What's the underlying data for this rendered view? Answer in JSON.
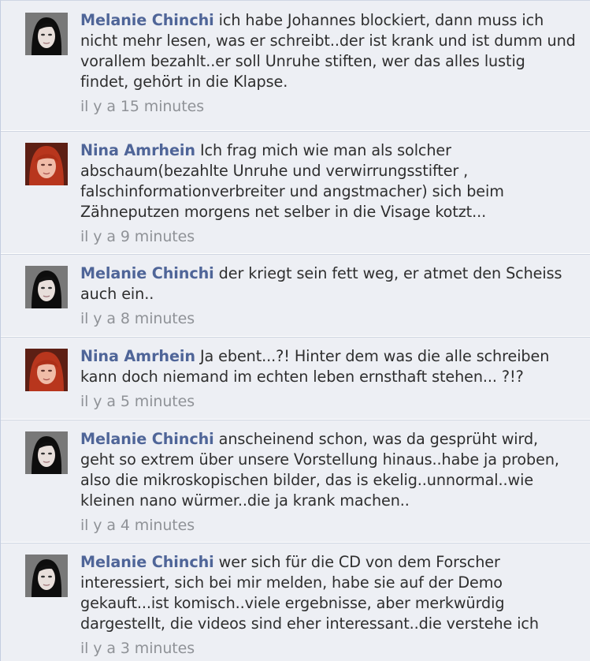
{
  "comments": [
    {
      "author": "Melanie Chinchi",
      "avatar": "melanie-avatar",
      "text": "ich habe Johannes blockiert, dann muss ich nicht mehr lesen, was er schreibt..der ist krank und ist dumm und vorallem bezahlt..er soll Unruhe stiften, wer das alles lustig findet, gehört in die Klapse.",
      "time": "il y a 15 minutes"
    },
    {
      "author": "Nina Amrhein",
      "avatar": "nina-avatar",
      "text": "Ich frag mich wie man als solcher abschaum(bezahlte Unruhe und verwirrungsstifter , falschinformationverbreiter und angstmacher) sich beim Zähneputzen morgens net selber in die Visage kotzt...",
      "time": "il y a 9 minutes"
    },
    {
      "author": "Melanie Chinchi",
      "avatar": "melanie-avatar",
      "text": "der kriegt sein fett weg, er atmet den Scheiss auch ein..",
      "time": "il y a 8 minutes"
    },
    {
      "author": "Nina Amrhein",
      "avatar": "nina-avatar",
      "text": "Ja ebent...?! Hinter dem was die alle schreiben kann doch niemand im echten leben ernsthaft stehen... ?!?",
      "time": "il y a 5 minutes"
    },
    {
      "author": "Melanie Chinchi",
      "avatar": "melanie-avatar",
      "text": "anscheinend schon, was da gesprüht wird, geht so extrem über unsere Vorstellung hinaus..habe ja proben, also die mikroskopischen bilder, das is ekelig..unnormal..wie kleinen nano würmer..die ja krank machen..",
      "time": "il y a 4 minutes"
    },
    {
      "author": "Melanie Chinchi",
      "avatar": "melanie-avatar",
      "text": "wer sich für die CD von dem Forscher interessiert, sich bei mir melden, habe sie auf der Demo gekauft...ist komisch..viele ergebnisse, aber merkwürdig dargestellt, die videos sind eher interessant..die verstehe ich",
      "time": "il y a 3 minutes"
    }
  ]
}
